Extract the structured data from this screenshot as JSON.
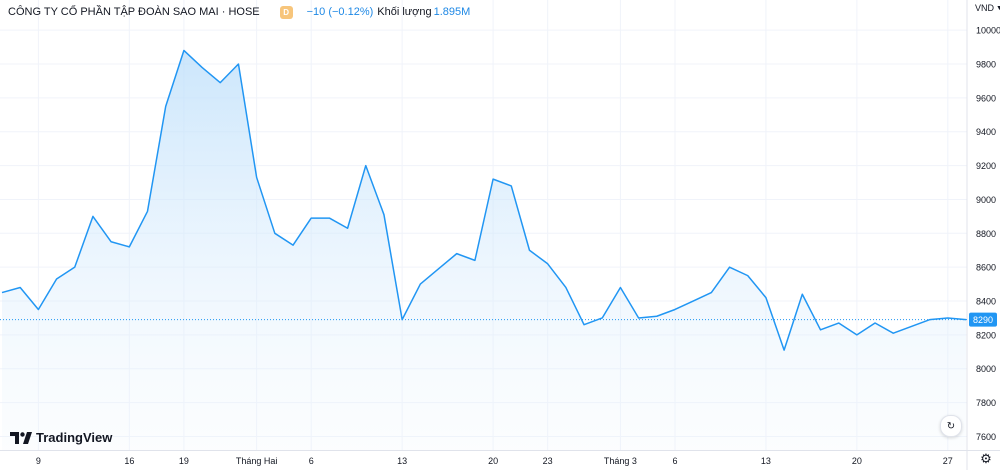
{
  "header": {
    "title": "CÔNG TY CỔ PHẦN TẬP ĐOÀN SAO MAI · HOSE",
    "interval_badge": "D",
    "change_text": "−10 (−0.12%)",
    "volume_label": "Khối lượng",
    "volume_value": "1.895M"
  },
  "currency": "VND",
  "logo_text": "TradingView",
  "colors": {
    "line": "#2196f3",
    "fill_top": "#bbdefb",
    "fill_bottom": "#eef6fd",
    "price_tag": "#2196f3",
    "text": "#131722",
    "grid": "#f0f3fa"
  },
  "icons": {
    "replay": "replay-icon",
    "settings": "settings-icon",
    "logo": "tradingview-logo-icon"
  },
  "chart_data": {
    "type": "area",
    "y_ticks": [
      7600,
      7800,
      8000,
      8200,
      8400,
      8600,
      8800,
      9000,
      9200,
      9400,
      9600,
      9800,
      10000
    ],
    "ylim": [
      7520,
      10060
    ],
    "x_ticks": [
      {
        "label": "9",
        "index": 2
      },
      {
        "label": "16",
        "index": 7
      },
      {
        "label": "19",
        "index": 10
      },
      {
        "label": "Tháng Hai",
        "index": 14
      },
      {
        "label": "6",
        "index": 17
      },
      {
        "label": "13",
        "index": 22
      },
      {
        "label": "20",
        "index": 27
      },
      {
        "label": "23",
        "index": 30
      },
      {
        "label": "Tháng 3",
        "index": 34
      },
      {
        "label": "6",
        "index": 37
      },
      {
        "label": "13",
        "index": 42
      },
      {
        "label": "20",
        "index": 47
      },
      {
        "label": "27",
        "index": 52
      }
    ],
    "values": [
      8450,
      8480,
      8350,
      8530,
      8600,
      8900,
      8750,
      8720,
      8930,
      9550,
      9880,
      9780,
      9690,
      9800,
      9130,
      8800,
      8730,
      8890,
      8890,
      8830,
      9200,
      8910,
      8290,
      8500,
      8590,
      8680,
      8640,
      9120,
      9080,
      8700,
      8620,
      8480,
      8260,
      8300,
      8480,
      8300,
      8310,
      8350,
      8400,
      8450,
      8600,
      8550,
      8420,
      8110,
      8440,
      8230,
      8270,
      8200,
      8270,
      8210,
      8250,
      8290,
      8300,
      8290
    ],
    "last_price": 8290,
    "last_price_label": "8290"
  }
}
